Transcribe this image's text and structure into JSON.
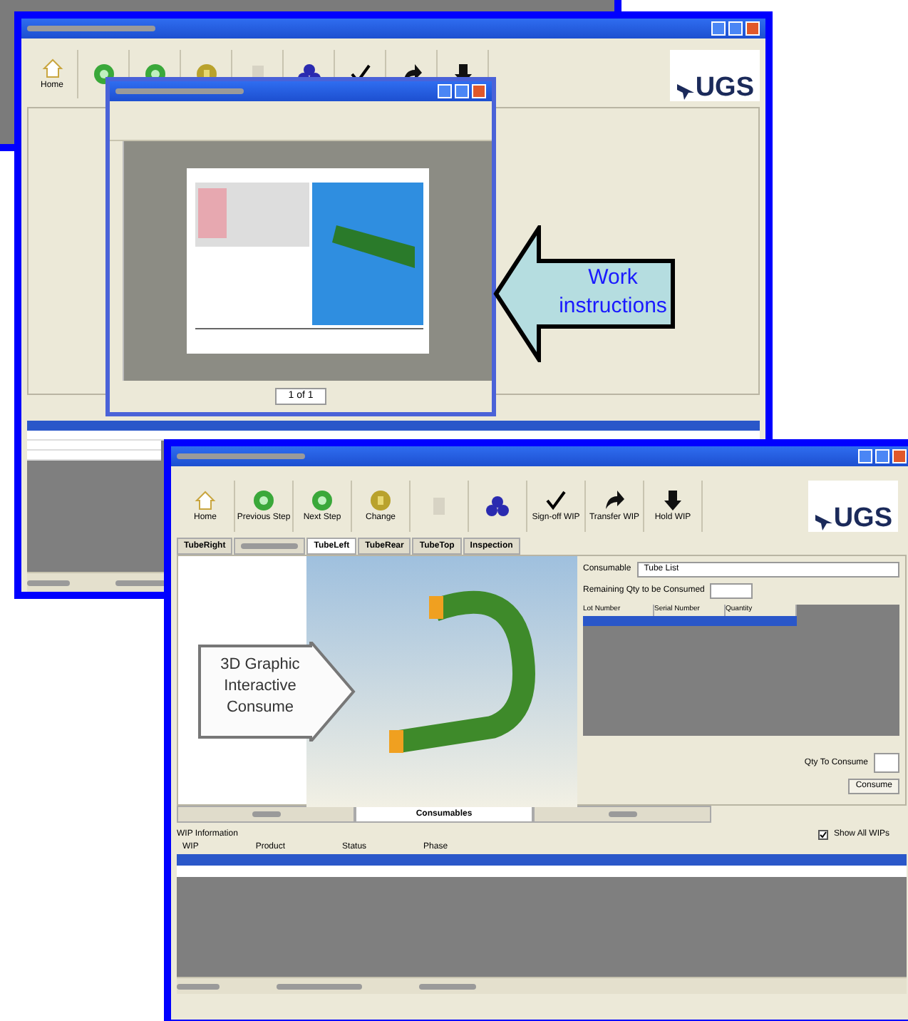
{
  "window_1": {
    "logo": "UGS",
    "toolbar": [
      {
        "kind": "home",
        "label": "Home"
      },
      {
        "kind": "green"
      },
      {
        "kind": "green"
      },
      {
        "kind": "yellow"
      },
      {
        "kind": "gray"
      },
      {
        "kind": "blue"
      },
      {
        "kind": "check"
      },
      {
        "kind": "arrow"
      },
      {
        "kind": "down"
      }
    ],
    "wip_rows": [
      {
        "selected": true
      },
      {
        "selected": false
      },
      {
        "selected": false
      },
      {
        "selected": false
      }
    ],
    "document_viewer": {
      "page_indicator": "1 of 1"
    }
  },
  "callout_1": {
    "text": "Work instructions"
  },
  "window_2": {
    "logo": "UGS",
    "toolbar": [
      {
        "kind": "home",
        "label": "Home"
      },
      {
        "kind": "green",
        "label": "Previous Step"
      },
      {
        "kind": "green",
        "label": "Next Step"
      },
      {
        "kind": "yellow",
        "label": "Change"
      },
      {
        "kind": "gray"
      },
      {
        "kind": "blue"
      },
      {
        "kind": "check",
        "label": "Sign-off WIP"
      },
      {
        "kind": "arrow",
        "label": "Transfer WIP"
      },
      {
        "kind": "down",
        "label": "Hold WIP"
      }
    ],
    "tabs": [
      {
        "label": "TubeRight",
        "selected": false
      },
      {
        "selected": false
      },
      {
        "label": "TubeLeft",
        "selected": true
      },
      {
        "label": "TubeRear",
        "selected": false
      },
      {
        "label": "TubeTop",
        "selected": false
      },
      {
        "label": "Inspection",
        "selected": false
      }
    ],
    "consumable": {
      "label": "Consumable",
      "value": "Tube List",
      "remaining_label": "Remaining Qty to be Consumed",
      "columns": [
        "Lot Number",
        "Serial Number",
        "Quantity"
      ],
      "rows": [
        {
          "selected": true
        }
      ],
      "qty_label": "Qty To Consume",
      "button": "Consume"
    },
    "bottom_tabs": [
      {
        "selected": false
      },
      {
        "label": "Consumables",
        "selected": true
      },
      {
        "selected": false
      }
    ],
    "wip": {
      "title": "WIP Information",
      "show_all": {
        "label": "Show All WIPs",
        "checked": true
      },
      "columns": [
        "WIP",
        "Product",
        "Status",
        "Phase"
      ],
      "rows": [
        {
          "selected": true
        },
        {
          "selected": false
        }
      ]
    }
  },
  "callout_2": {
    "text": "3D Graphic Interactive Consume"
  }
}
